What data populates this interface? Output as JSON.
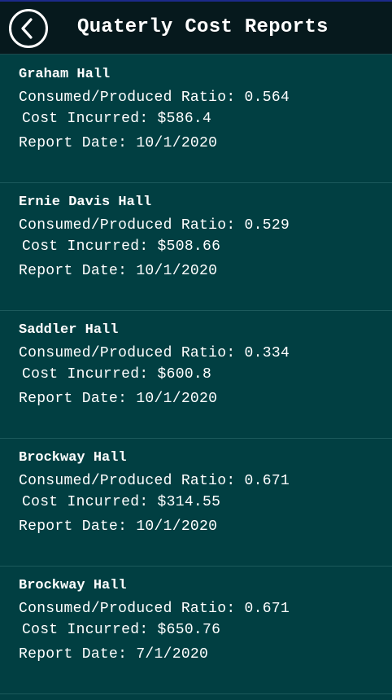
{
  "header": {
    "title": "Quaterly Cost Reports",
    "back_icon": "chevron-left-icon"
  },
  "reports": [
    {
      "name": "Graham Hall",
      "ratio_line": "Consumed/Produced Ratio: 0.564",
      "cost_line": "Cost Incurred: $586.4",
      "date_line": "Report Date: 10/1/2020"
    },
    {
      "name": "Ernie Davis Hall",
      "ratio_line": "Consumed/Produced Ratio: 0.529",
      "cost_line": "Cost Incurred: $508.66",
      "date_line": "Report Date: 10/1/2020"
    },
    {
      "name": "Saddler Hall",
      "ratio_line": "Consumed/Produced Ratio: 0.334",
      "cost_line": "Cost Incurred: $600.8",
      "date_line": "Report Date: 10/1/2020"
    },
    {
      "name": "Brockway Hall",
      "ratio_line": "Consumed/Produced Ratio: 0.671",
      "cost_line": "Cost Incurred: $314.55",
      "date_line": "Report Date: 10/1/2020"
    },
    {
      "name": "Brockway Hall",
      "ratio_line": "Consumed/Produced Ratio: 0.671",
      "cost_line": "Cost Incurred: $650.76",
      "date_line": "Report Date: 7/1/2020"
    }
  ],
  "colors": {
    "background": "#013f42",
    "header_background": "#06191d",
    "divider": "#1c5a5c",
    "text": "#ffffff"
  }
}
